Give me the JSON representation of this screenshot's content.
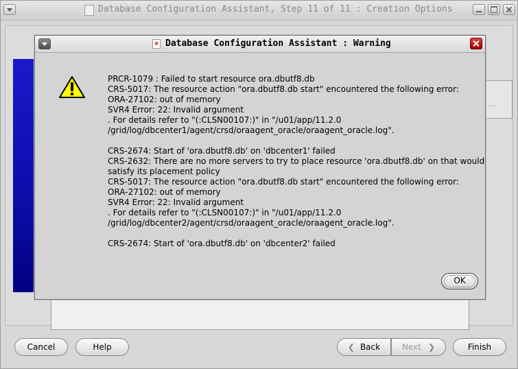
{
  "main_window": {
    "title": "Database Configuration Assistant, Step 11 of 11 : Creation Options"
  },
  "dialog": {
    "title": "Database Configuration Assistant : Warning",
    "message_lines": [
      "PRCR-1079 : Failed to start resource ora.dbutf8.db",
      "CRS-5017: The resource action \"ora.dbutf8.db start\" encountered the following error:",
      "ORA-27102: out of memory",
      "SVR4 Error: 22: Invalid argument",
      ". For details refer to \"(:CLSN00107:)\" in \"/u01/app/11.2.0",
      "/grid/log/dbcenter1/agent/crsd/oraagent_oracle/oraagent_oracle.log\".",
      "",
      "CRS-2674: Start of 'ora.dbutf8.db' on 'dbcenter1' failed",
      "CRS-2632: There are no more servers to try to place resource 'ora.dbutf8.db' on that would",
      "satisfy its placement policy",
      "CRS-5017: The resource action \"ora.dbutf8.db start\" encountered the following error:",
      "ORA-27102: out of memory",
      "SVR4 Error: 22: Invalid argument",
      ". For details refer to \"(:CLSN00107:)\" in \"/u01/app/11.2.0",
      "/grid/log/dbcenter2/agent/crsd/oraagent_oracle/oraagent_oracle.log\".",
      "",
      "CRS-2674: Start of 'ora.dbutf8.db' on 'dbcenter2' failed"
    ],
    "ok_label": "OK",
    "icon": "warning-triangle-icon"
  },
  "buttons": {
    "cancel": "Cancel",
    "help": "Help",
    "back": "Back",
    "next": "Next",
    "finish": "Finish"
  },
  "side_button_label": "...",
  "colors": {
    "banner": "#1010b8",
    "warning_yellow": "#ffff00",
    "close_red": "#c02020"
  }
}
